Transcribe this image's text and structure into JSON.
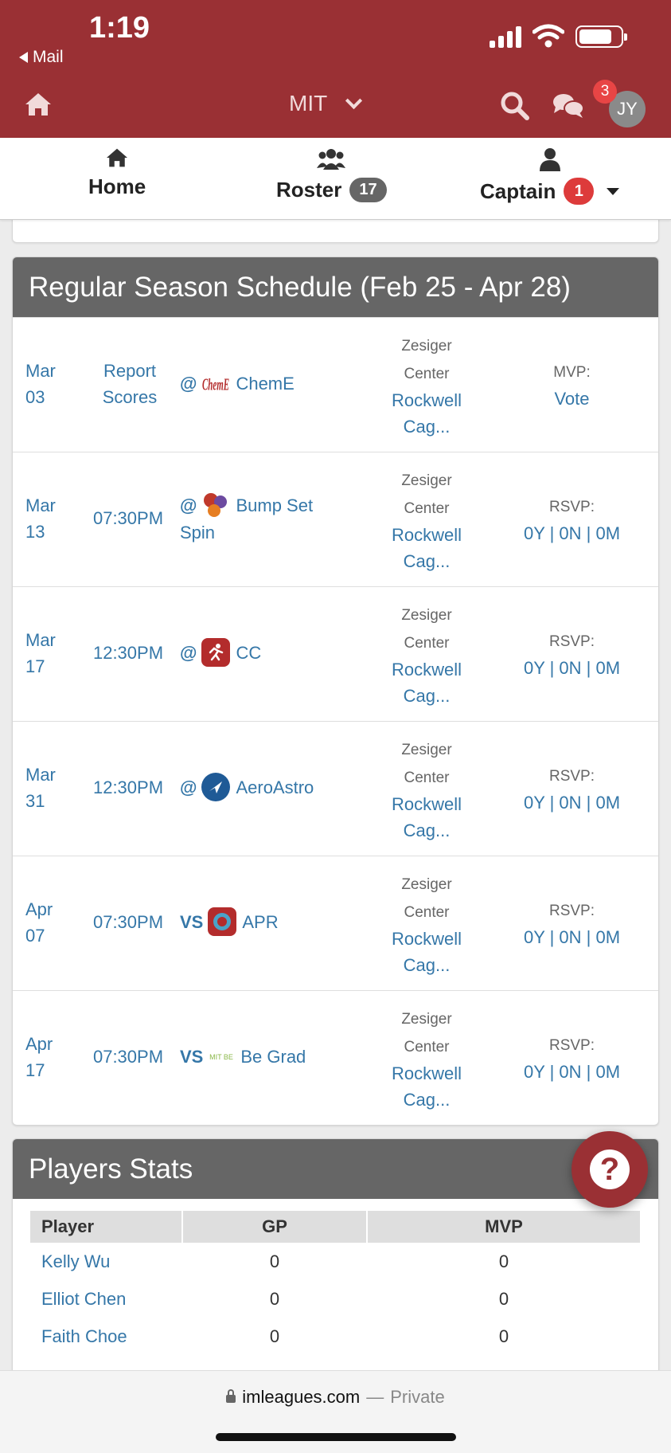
{
  "status_bar": {
    "time": "1:19",
    "back_label": "Mail"
  },
  "header": {
    "org_name": "MIT",
    "notification_count": "3",
    "avatar_initials": "JY",
    "accent_color": "#9a3034"
  },
  "subnav": {
    "home_label": "Home",
    "roster_label": "Roster",
    "roster_count": "17",
    "captain_label": "Captain",
    "captain_count": "1"
  },
  "schedule": {
    "title": "Regular Season Schedule (Feb 25 - Apr 28)",
    "games": [
      {
        "month": "Mar",
        "day": "03",
        "time": "Report Scores",
        "prefix": "@",
        "opponent": "ChemE",
        "opponent_line2": "",
        "location_top1": "Zesiger",
        "location_top2": "Center",
        "location_link1": "Rockwell",
        "location_link2": "Cag...",
        "status_label": "MVP:",
        "status_value": "Vote"
      },
      {
        "month": "Mar",
        "day": "13",
        "time": "07:30PM",
        "prefix": "@",
        "opponent": "Bump Set",
        "opponent_line2": "Spin",
        "location_top1": "Zesiger",
        "location_top2": "Center",
        "location_link1": "Rockwell",
        "location_link2": "Cag...",
        "status_label": "RSVP:",
        "status_value": "0Y | 0N | 0M"
      },
      {
        "month": "Mar",
        "day": "17",
        "time": "12:30PM",
        "prefix": "@",
        "opponent": "CC",
        "opponent_line2": "",
        "location_top1": "Zesiger",
        "location_top2": "Center",
        "location_link1": "Rockwell",
        "location_link2": "Cag...",
        "status_label": "RSVP:",
        "status_value": "0Y | 0N | 0M"
      },
      {
        "month": "Mar",
        "day": "31",
        "time": "12:30PM",
        "prefix": "@",
        "opponent": "AeroAstro",
        "opponent_line2": "",
        "location_top1": "Zesiger",
        "location_top2": "Center",
        "location_link1": "Rockwell",
        "location_link2": "Cag...",
        "status_label": "RSVP:",
        "status_value": "0Y | 0N | 0M"
      },
      {
        "month": "Apr",
        "day": "07",
        "time": "07:30PM",
        "prefix": "VS",
        "opponent": "APR",
        "opponent_line2": "",
        "location_top1": "Zesiger",
        "location_top2": "Center",
        "location_link1": "Rockwell",
        "location_link2": "Cag...",
        "status_label": "RSVP:",
        "status_value": "0Y | 0N | 0M"
      },
      {
        "month": "Apr",
        "day": "17",
        "time": "07:30PM",
        "prefix": "VS",
        "opponent": "Be Grad",
        "opponent_line2": "",
        "location_top1": "Zesiger",
        "location_top2": "Center",
        "location_link1": "Rockwell",
        "location_link2": "Cag...",
        "status_label": "RSVP:",
        "status_value": "0Y | 0N | 0M"
      }
    ],
    "logo_text": {
      "cheme": "ChemE",
      "begrad": "MIT BE"
    }
  },
  "players_stats": {
    "title": "Players Stats",
    "columns": [
      "Player",
      "GP",
      "MVP"
    ],
    "rows": [
      {
        "name": "Kelly Wu",
        "gp": "0",
        "mvp": "0"
      },
      {
        "name": "Elliot Chen",
        "gp": "0",
        "mvp": "0"
      },
      {
        "name": "Faith Choe",
        "gp": "0",
        "mvp": "0"
      }
    ]
  },
  "browser": {
    "domain": "imleagues.com",
    "separator": "—",
    "mode": "Private"
  },
  "help": {
    "glyph": "?"
  }
}
